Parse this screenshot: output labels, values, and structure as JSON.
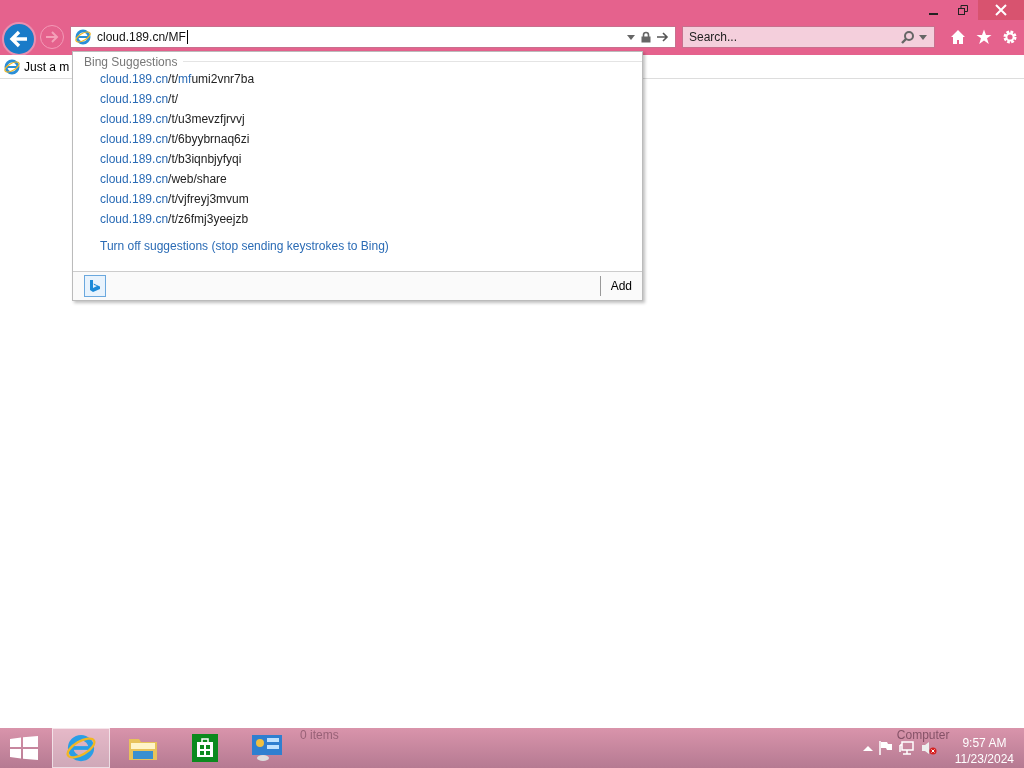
{
  "address_bar": {
    "value": "cloud.189.cn/MF"
  },
  "search": {
    "placeholder": "Search..."
  },
  "tabs": [
    {
      "label": "Just a m",
      "selected": true
    }
  ],
  "suggestions": {
    "heading": "Bing Suggestions",
    "items": [
      {
        "parts": [
          {
            "text": "cloud.189.cn",
            "match": true
          },
          {
            "text": "/t/",
            "match": false
          },
          {
            "text": "mf",
            "match": true
          },
          {
            "text": "umi2vnr7ba",
            "match": false
          }
        ]
      },
      {
        "parts": [
          {
            "text": "cloud.189.cn",
            "match": true
          },
          {
            "text": "/t/",
            "match": false
          }
        ]
      },
      {
        "parts": [
          {
            "text": "cloud.189.cn",
            "match": true
          },
          {
            "text": "/t/u3mevzfjrvvj",
            "match": false
          }
        ]
      },
      {
        "parts": [
          {
            "text": "cloud.189.cn",
            "match": true
          },
          {
            "text": "/t/6byybrnaq6zi",
            "match": false
          }
        ]
      },
      {
        "parts": [
          {
            "text": "cloud.189.cn",
            "match": true
          },
          {
            "text": "/t/b3iqnbjyfyqi",
            "match": false
          }
        ]
      },
      {
        "parts": [
          {
            "text": "cloud.189.cn",
            "match": true
          },
          {
            "text": "/web/share",
            "match": false
          }
        ]
      },
      {
        "parts": [
          {
            "text": "cloud.189.cn",
            "match": true
          },
          {
            "text": "/t/vjfreyj3mvum",
            "match": false
          }
        ]
      },
      {
        "parts": [
          {
            "text": "cloud.189.cn",
            "match": true
          },
          {
            "text": "/t/z6fmj3yeejzb",
            "match": false
          }
        ]
      }
    ],
    "turn_off_link": "Turn off suggestions (stop sending keystrokes to Bing)",
    "add_button": "Add"
  },
  "taskbar": {
    "apps": [
      {
        "kind": "ie",
        "selected": true
      },
      {
        "kind": "explorer",
        "selected": false
      },
      {
        "kind": "store",
        "selected": false
      },
      {
        "kind": "control",
        "selected": false
      }
    ],
    "ghost_texts": [
      "0 items",
      "Computer"
    ],
    "time": "9:57 AM",
    "date": "11/23/2024"
  }
}
